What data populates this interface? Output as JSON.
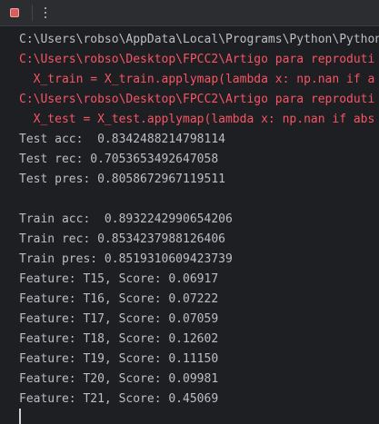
{
  "console": {
    "lines": [
      {
        "text": "C:\\Users\\robso\\AppData\\Local\\Programs\\Python\\Python",
        "type": "normal"
      },
      {
        "text": "C:\\Users\\robso\\Desktop\\FPCC2\\Artigo para reproduti",
        "type": "error"
      },
      {
        "text": "  X_train = X_train.applymap(lambda x: np.nan if a",
        "type": "error"
      },
      {
        "text": "C:\\Users\\robso\\Desktop\\FPCC2\\Artigo para reproduti",
        "type": "error"
      },
      {
        "text": "  X_test = X_test.applymap(lambda x: np.nan if abs",
        "type": "error"
      },
      {
        "text": "Test acc:  0.8342488214798114",
        "type": "normal"
      },
      {
        "text": "Test rec: 0.7053653492647058",
        "type": "normal"
      },
      {
        "text": "Test pres: 0.8058672967119511",
        "type": "normal"
      },
      {
        "text": "",
        "type": "normal"
      },
      {
        "text": "Train acc:  0.8932242990654206",
        "type": "normal"
      },
      {
        "text": "Train rec: 0.8534237988126406",
        "type": "normal"
      },
      {
        "text": "Train pres: 0.8519310609423739",
        "type": "normal"
      },
      {
        "text": "Feature: T15, Score: 0.06917",
        "type": "normal"
      },
      {
        "text": "Feature: T16, Score: 0.07222",
        "type": "normal"
      },
      {
        "text": "Feature: T17, Score: 0.07059",
        "type": "normal"
      },
      {
        "text": "Feature: T18, Score: 0.12602",
        "type": "normal"
      },
      {
        "text": "Feature: T19, Score: 0.11150",
        "type": "normal"
      },
      {
        "text": "Feature: T20, Score: 0.09981",
        "type": "normal"
      },
      {
        "text": "Feature: T21, Score: 0.45069",
        "type": "normal"
      }
    ]
  },
  "colors": {
    "background": "#1e1f22",
    "text": "#bcbec4",
    "error_text": "#f75464",
    "stop_icon": "#db5c5c"
  },
  "icons": {
    "stop": "stop-icon",
    "more": "more-vertical-icon"
  }
}
